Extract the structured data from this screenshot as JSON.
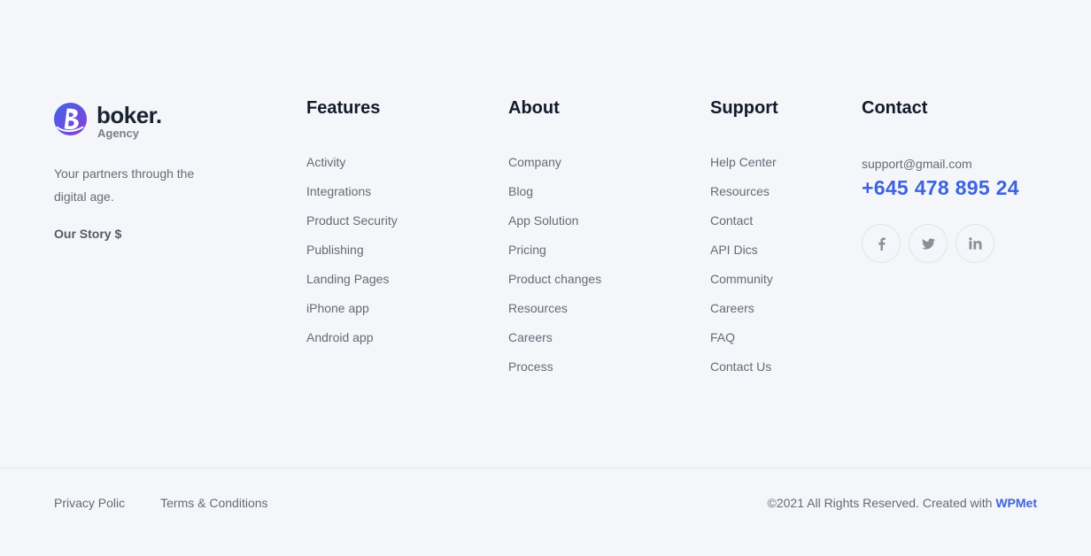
{
  "brand": {
    "name": "boker.",
    "sub": "Agency",
    "tagline": "Your partners through the digital age.",
    "story_link": "Our Story $",
    "logo_icon": "boker-logo-icon",
    "colors": {
      "mark_start": "#4a5ae0",
      "mark_end": "#8a3fd6"
    }
  },
  "features": {
    "heading": "Features",
    "items": [
      "Activity",
      "Integrations",
      "Product Security",
      "Publishing",
      "Landing Pages",
      "iPhone app",
      "Android app"
    ]
  },
  "about": {
    "heading": "About",
    "items": [
      "Company",
      "Blog",
      "App Solution",
      "Pricing",
      "Product changes",
      "Resources",
      "Careers",
      "Process"
    ]
  },
  "support": {
    "heading": "Support",
    "items": [
      "Help Center",
      "Resources",
      "Contact",
      "API Dics",
      "Community",
      "Careers",
      "FAQ",
      "Contact Us"
    ]
  },
  "contact": {
    "heading": "Contact",
    "email": "support@gmail.com",
    "phone": "+645 478 895 24",
    "socials": [
      {
        "icon": "facebook-icon",
        "glyph": "f"
      },
      {
        "icon": "twitter-icon",
        "glyph": ""
      },
      {
        "icon": "linkedin-icon",
        "glyph": "in"
      }
    ]
  },
  "bottom": {
    "links": [
      "Privacy Polic",
      "Terms & Conditions"
    ],
    "copyright_text": "©2021 All Rights Reserved. Created with ",
    "copyright_link": "WPMet"
  },
  "colors": {
    "background": "#f4f6f9",
    "accent": "#3e64de",
    "heading": "#131a2b",
    "text": "#666b76"
  }
}
